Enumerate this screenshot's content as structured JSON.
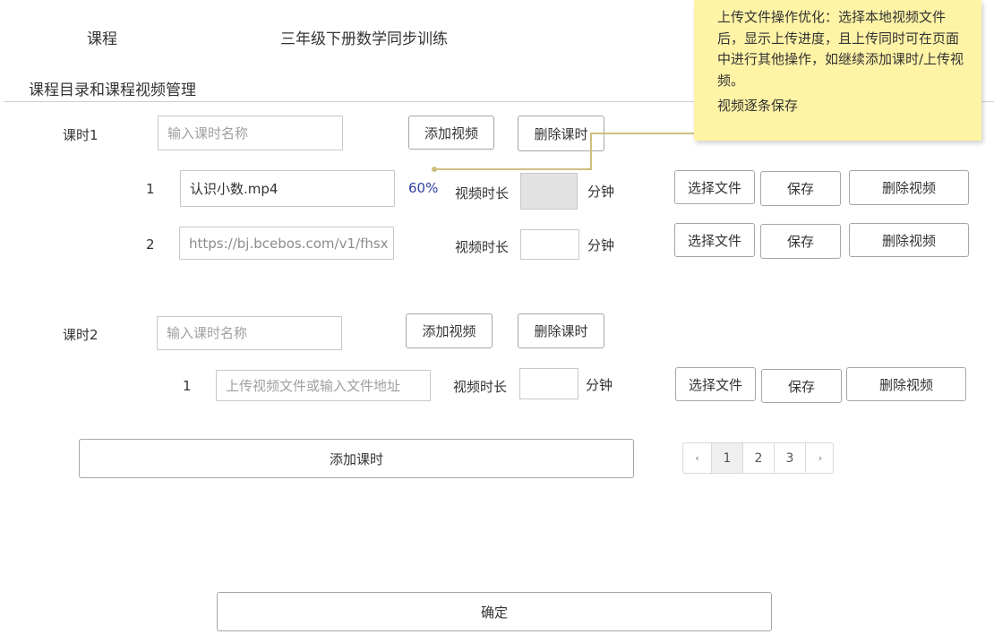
{
  "header": {
    "course_label": "课程",
    "course_name": "三年级下册数学同步训练"
  },
  "section_title": "课程目录和课程视频管理",
  "note": {
    "line1": "上传文件操作优化：选择本地视频文件后，显示上传进度，且上传同时可在页面中进行其他操作，如继续添加课时/上传视频。",
    "line2": "视频逐条保存"
  },
  "lessons": [
    {
      "label": "课时1",
      "name_placeholder": "输入课时名称",
      "add_video": "添加视频",
      "delete_lesson": "删除课时",
      "videos": [
        {
          "index": "1",
          "value": "认识小数.mp4",
          "progress": "60%",
          "duration_label": "视频时长",
          "unit": "分钟",
          "choose": "选择文件",
          "save": "保存",
          "delete": "删除视频"
        },
        {
          "index": "2",
          "value": "https://bj.bcebos.com/v1/fhsx",
          "duration_label": "视频时长",
          "unit": "分钟",
          "choose": "选择文件",
          "save": "保存",
          "delete": "删除视频"
        }
      ]
    },
    {
      "label": "课时2",
      "name_placeholder": "输入课时名称",
      "add_video": "添加视频",
      "delete_lesson": "删除课时",
      "videos": [
        {
          "index": "1",
          "placeholder": "上传视频文件或输入文件地址",
          "duration_label": "视频时长",
          "unit": "分钟",
          "choose": "选择文件",
          "save": "保存",
          "delete": "删除视频"
        }
      ]
    }
  ],
  "add_lesson": "添加课时",
  "pagination": {
    "prev": "‹",
    "pages": [
      "1",
      "2",
      "3"
    ],
    "current": "1",
    "next": "›"
  },
  "confirm": "确定",
  "colors": {
    "note_bg": "#fff4a6",
    "connector": "#cdbf7d",
    "progress_text": "#2c3e9e"
  }
}
